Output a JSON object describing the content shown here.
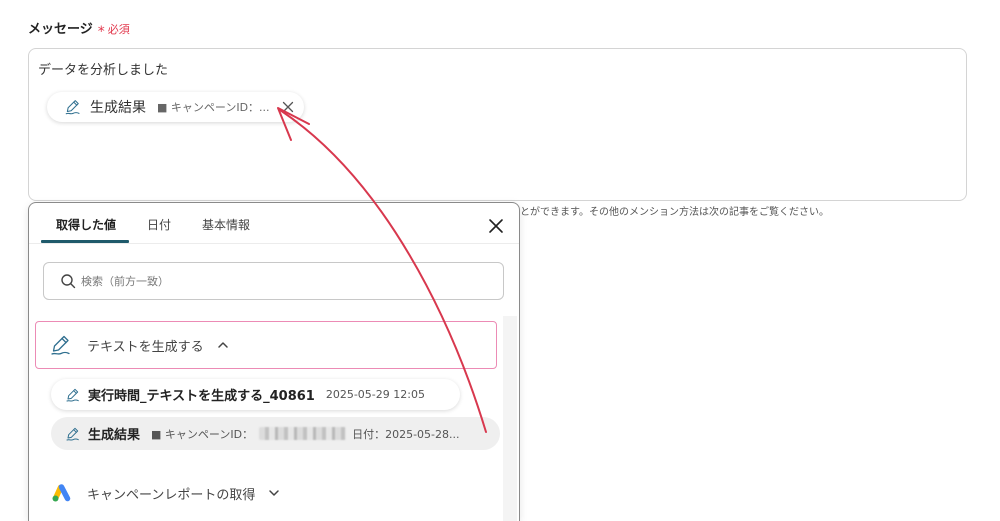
{
  "form": {
    "label": "メッセージ",
    "required_mark": "*",
    "required_text": "必須",
    "message_text": "データを分析しました",
    "chip": {
      "icon": "generate-text-icon",
      "title": "生成結果",
      "detail": "■ キャンペーンID：..."
    },
    "helper_text": "とができます。その他のメンション方法は次の記事をご覧ください。"
  },
  "popup": {
    "tabs": [
      {
        "label": "取得した値",
        "active": true
      },
      {
        "label": "日付",
        "active": false
      },
      {
        "label": "基本情報",
        "active": false
      }
    ],
    "search": {
      "placeholder": "検索（前方一致）"
    },
    "sections": [
      {
        "icon": "generate-text-icon",
        "title": "テキストを生成する",
        "expanded": true,
        "items": [
          {
            "title": "実行時間_テキストを生成する_40861",
            "detail": "2025-05-29 12:05"
          },
          {
            "title": "生成結果",
            "detail": "■ キャンペーンID：",
            "detail_after": "日付：2025-05-28..."
          }
        ]
      },
      {
        "icon": "google-ads-icon",
        "title": "キャンペーンレポートの取得",
        "expanded": false
      }
    ]
  },
  "colors": {
    "required": "#e2384d",
    "tab_indicator": "#1f5a6b",
    "highlight_border": "#ec8bb5",
    "annotation_arrow": "#d8384e",
    "item_icon": "#2f6f8f"
  }
}
